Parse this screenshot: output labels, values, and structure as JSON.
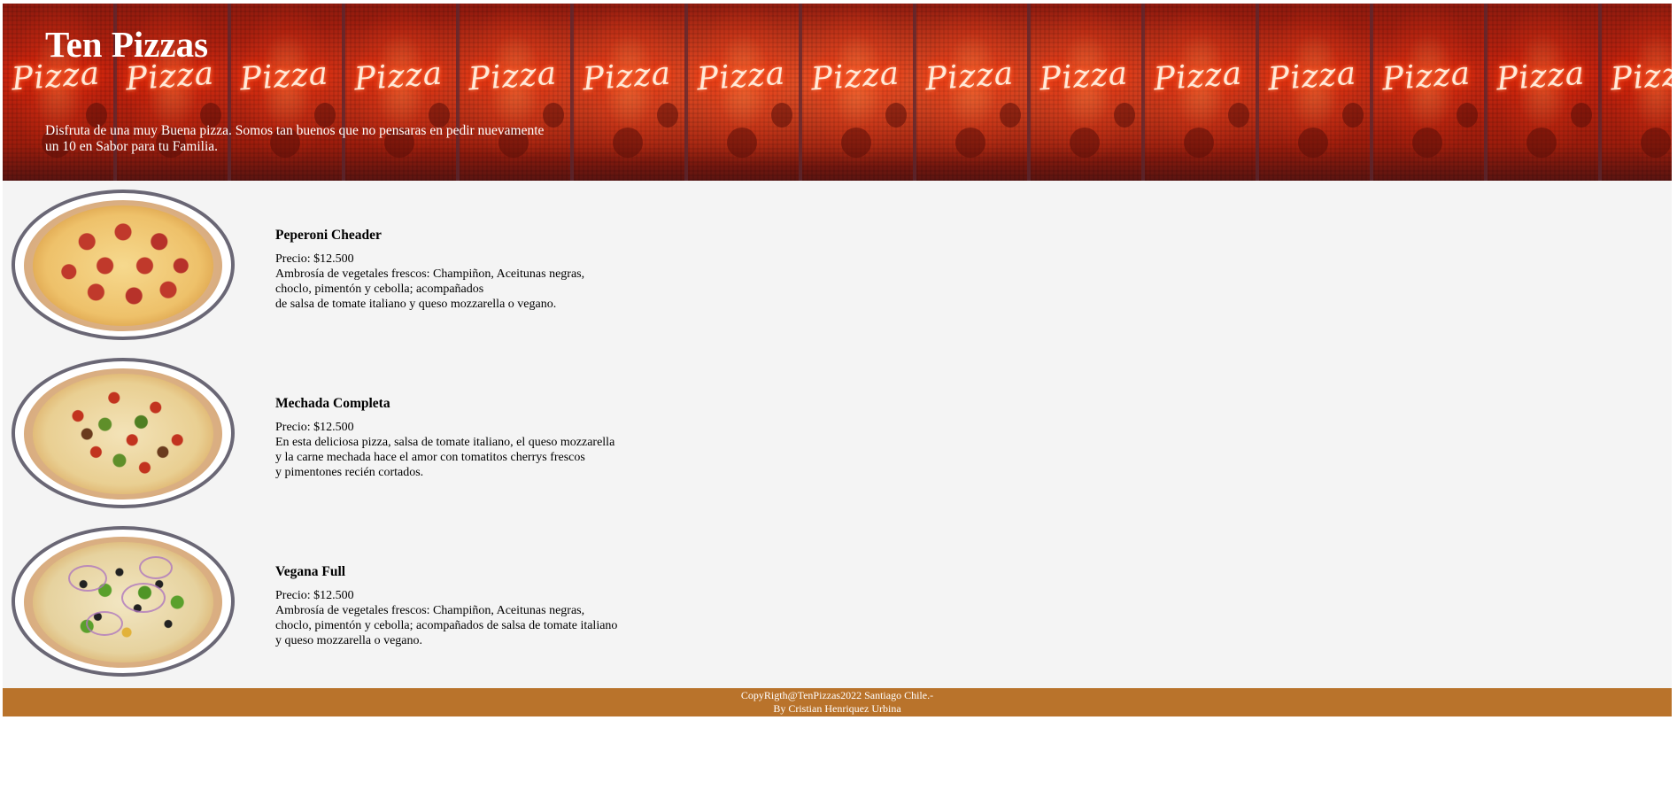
{
  "header": {
    "title": "Ten Pizzas",
    "subtitle_line1": "Disfruta de una muy Buena pizza. Somos tan buenos que no pensaras en pedir nuevamente",
    "subtitle_line2": "un 10 en Sabor para tu Familia.",
    "banner_neon_text": "Pizza",
    "banner_panel_count": 15
  },
  "menu": {
    "items": [
      {
        "name": "Peperoni Cheader",
        "price": "Precio: $12.500",
        "desc_lines": [
          "Ambrosía de vegetales frescos: Champiñon, Aceitunas negras,",
          "choclo, pimentón y cebolla; acompañados",
          "de salsa de tomate italiano y queso mozzarella o vegano."
        ],
        "image": "pizza-pepperoni-image"
      },
      {
        "name": "Mechada Completa",
        "price": "Precio: $12.500",
        "desc_lines": [
          "En esta deliciosa pizza, salsa de tomate italiano, el queso mozzarella",
          "y la carne mechada hace el amor con tomatitos cherrys frescos",
          "y pimentones recién cortados."
        ],
        "image": "pizza-mechada-image"
      },
      {
        "name": "Vegana Full",
        "price": "Precio: $12.500",
        "desc_lines": [
          "Ambrosía de vegetales frescos: Champiñon, Aceitunas negras,",
          "choclo, pimentón y cebolla; acompañados de salsa de tomate italiano",
          "y queso mozzarella o vegano."
        ],
        "image": "pizza-vegana-image"
      }
    ]
  },
  "footer": {
    "line1": "CopyRigth@TenPizzas2022 Santiago Chile.-",
    "line2": "By Cristian Henriquez Urbina"
  },
  "colors": {
    "banner_red": "#c8250f",
    "menu_background": "#f4f4f4",
    "frame_border": "#6a6775",
    "footer_background": "#b9732b"
  }
}
